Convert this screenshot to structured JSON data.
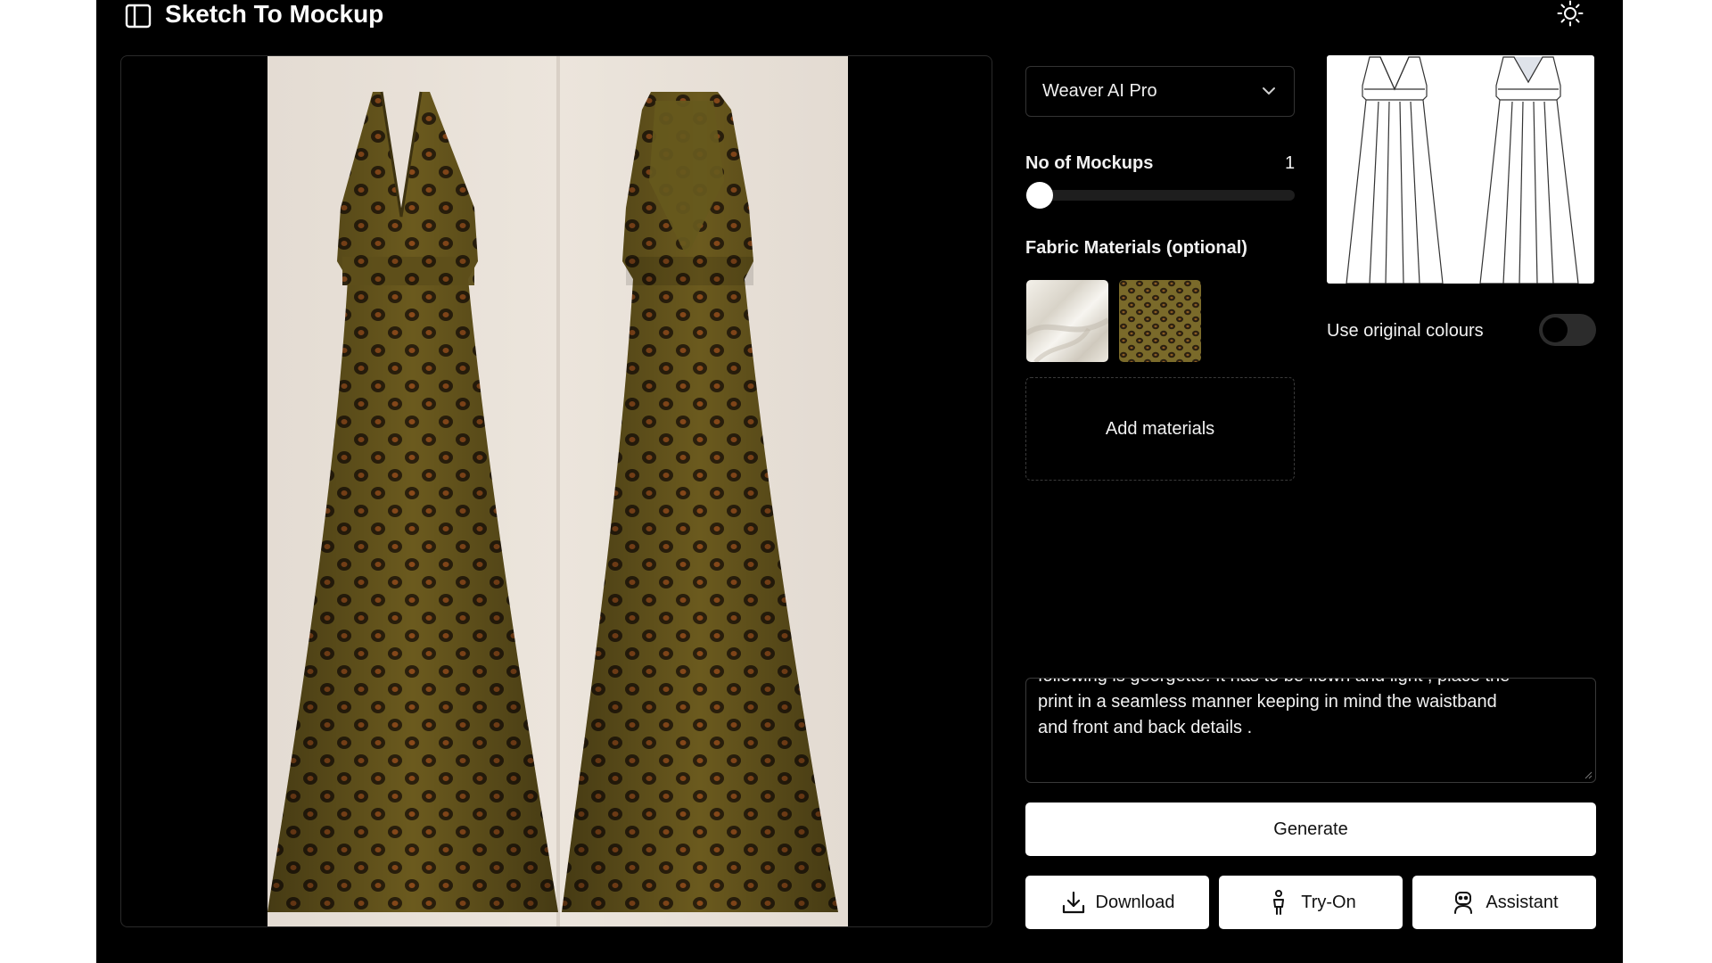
{
  "header": {
    "title": "Sketch To Mockup",
    "sidebar_icon": "sidebar-panel-icon",
    "theme_icon": "sun-icon"
  },
  "preview": {
    "image": "dress-mockup-front-back"
  },
  "controls": {
    "model_select": {
      "value": "Weaver AI Pro",
      "icon": "chevron-down-icon"
    },
    "mockups": {
      "label": "No of Mockups",
      "value": "1",
      "slider_fraction": 0
    },
    "fabric": {
      "label": "Fabric Materials (optional)",
      "swatches": [
        "white-georgette-swatch",
        "leopard-print-swatch"
      ],
      "add_label": "Add materials"
    }
  },
  "sketch": {
    "image": "dress-technical-sketch"
  },
  "options": {
    "original_colours_label": "Use original colours",
    "original_colours_on": false
  },
  "prompt": {
    "text": "following is georgette. It has to be flown and light , place the\nprint in a seamless manner keeping in mind the waistband\nand front and back details ."
  },
  "actions": {
    "generate_label": "Generate",
    "download_label": "Download",
    "tryon_label": "Try-On",
    "assistant_label": "Assistant"
  },
  "colors": {
    "background": "#000000",
    "button": "#ffffff",
    "dress_base": "#6b5a1e",
    "dress_spot": "#2a1f0c",
    "dress_spot_center": "#8a4a1a"
  }
}
